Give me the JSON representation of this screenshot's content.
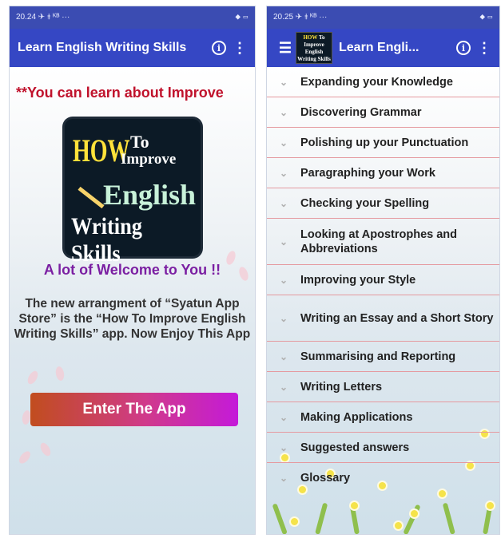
{
  "left": {
    "status_time": "20.24 ✈ ⯒ ᴷᴮ ···",
    "status_right": "⯁ ▭",
    "title": "Learn English Writing Skills",
    "info_icon": "info-icon",
    "more_icon": "more-vert-icon",
    "marquee": "**You can learn about Improve",
    "logo": {
      "how": "HOW",
      "to": "To",
      "improve": "Improve",
      "english": "English",
      "writing_skills": "Writing Skills"
    },
    "welcome": "A lot of Welcome to You !!",
    "description": "The new arrangment of “Syatun App Store” is the “How To Improve English Writing Skills” app. Now Enjoy This App",
    "enter_button": "Enter The App"
  },
  "right": {
    "status_time": "20.25 ✈ ⯒ ᴷᴮ ···",
    "status_right": "⯁ ▭",
    "menu_icon": "hamburger-icon",
    "title": "Learn Engli...",
    "mini_logo": {
      "how": "HOW",
      "to": "To",
      "improve": "Improve",
      "english": "English",
      "writing_skills": "Writing Skills"
    },
    "items": [
      {
        "label": "Expanding your Knowledge"
      },
      {
        "label": "Discovering Grammar"
      },
      {
        "label": "Polishing up your Punctuation"
      },
      {
        "label": "Paragraphing your Work"
      },
      {
        "label": "Checking your Spelling"
      },
      {
        "label": "Looking at Apostrophes and Abbreviations"
      },
      {
        "label": "Improving your Style"
      },
      {
        "label": "Writing an Essay and a Short Story"
      },
      {
        "label": "Summarising and Reporting"
      },
      {
        "label": "Writing Letters"
      },
      {
        "label": "Making Applications"
      },
      {
        "label": "Suggested answers"
      },
      {
        "label": "Glossary"
      }
    ]
  },
  "colors": {
    "appbar": "#3547c4",
    "marquee": "#c0122c",
    "welcome": "#7b1fa2",
    "divider": "#e59aa0"
  }
}
